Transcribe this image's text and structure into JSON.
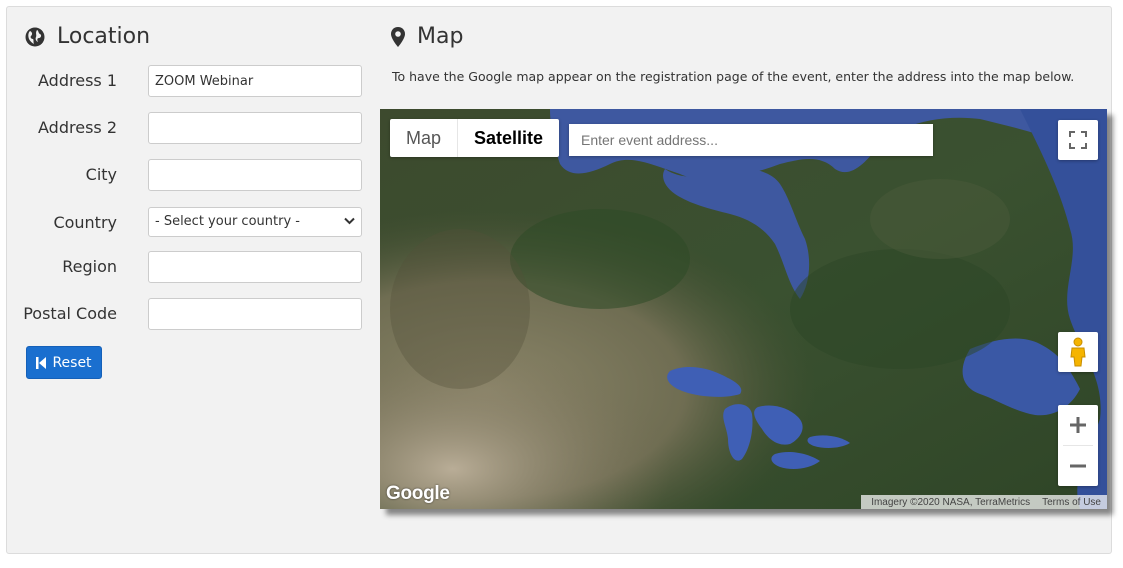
{
  "location": {
    "title": "Location",
    "fields": [
      {
        "label": "Address 1",
        "value": "ZOOM Webinar"
      },
      {
        "label": "Address 2",
        "value": ""
      },
      {
        "label": "City",
        "value": ""
      },
      {
        "label": "Country",
        "value": "- Select your country -"
      },
      {
        "label": "Region",
        "value": ""
      },
      {
        "label": "Postal Code",
        "value": ""
      }
    ],
    "reset_label": "Reset"
  },
  "map": {
    "title": "Map",
    "intro": "To have the Google map appear on the registration page of the event, enter the address into the map below.",
    "type_map_label": "Map",
    "type_satellite_label": "Satellite",
    "search_placeholder": "Enter event address...",
    "logo_text": "Google",
    "attribution": "Imagery ©2020 NASA, TerraMetrics",
    "terms_label": "Terms of Use"
  },
  "colors": {
    "accent": "#1a6fcf",
    "panel_bg": "#f2f2f2"
  },
  "icons": {
    "location_title": "globe-icon",
    "map_title": "map-marker-icon",
    "reset": "step-backward-icon",
    "fullscreen": "fullscreen-icon",
    "street_view": "pegman-icon",
    "zoom_in": "plus-icon",
    "zoom_out": "minus-icon"
  }
}
